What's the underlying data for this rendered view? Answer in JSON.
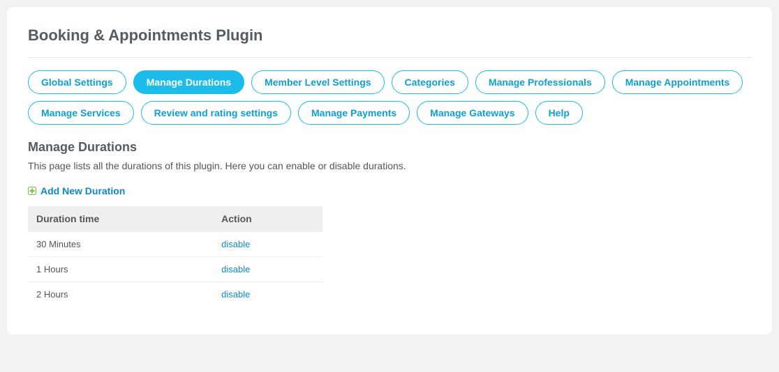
{
  "header": {
    "title": "Booking & Appointments Plugin"
  },
  "tabs": [
    {
      "label": "Global Settings",
      "active": false
    },
    {
      "label": "Manage Durations",
      "active": true
    },
    {
      "label": "Member Level Settings",
      "active": false
    },
    {
      "label": "Categories",
      "active": false
    },
    {
      "label": "Manage Professionals",
      "active": false
    },
    {
      "label": "Manage Appointments",
      "active": false
    },
    {
      "label": "Manage Services",
      "active": false
    },
    {
      "label": "Review and rating settings",
      "active": false
    },
    {
      "label": "Manage Payments",
      "active": false
    },
    {
      "label": "Manage Gateways",
      "active": false
    },
    {
      "label": "Help",
      "active": false
    }
  ],
  "section": {
    "title": "Manage Durations",
    "description": "This page lists all the durations of this plugin. Here you can enable or disable durations.",
    "add_label": "Add New Duration"
  },
  "table": {
    "headers": {
      "duration": "Duration time",
      "action": "Action"
    },
    "rows": [
      {
        "duration": "30 Minutes",
        "action": "disable"
      },
      {
        "duration": "1 Hours",
        "action": "disable"
      },
      {
        "duration": "2 Hours",
        "action": "disable"
      }
    ]
  }
}
